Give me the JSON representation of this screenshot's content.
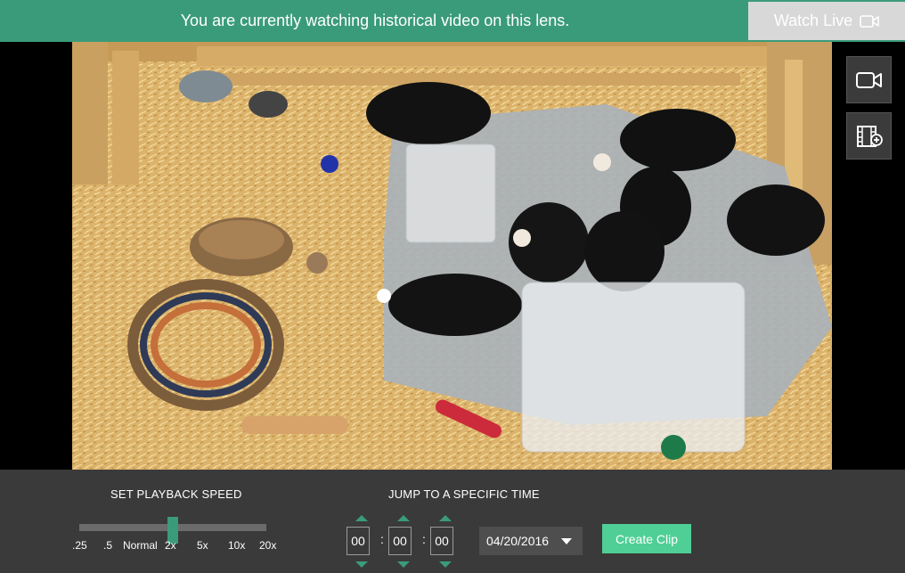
{
  "banner": {
    "message": "You are currently watching historical video on this lens.",
    "watch_live_label": "Watch Live",
    "watch_live_icon": "video-camera-icon"
  },
  "side_buttons": [
    {
      "name": "live-camera-button",
      "icon": "video-camera-icon"
    },
    {
      "name": "add-clip-button",
      "icon": "film-add-icon"
    }
  ],
  "controls": {
    "playback_title": "SET PLAYBACK SPEED",
    "speed_options": [
      ".25",
      ".5",
      "Normal",
      "2x",
      "5x",
      "10x",
      "20x"
    ],
    "selected_speed": "2x",
    "jump_title": "JUMP TO A SPECIFIC TIME",
    "time": {
      "hours": "00",
      "minutes": "00",
      "seconds": "00"
    },
    "date": "04/20/2016",
    "create_clip_label": "Create Clip"
  },
  "colors": {
    "accent": "#3a9b7a",
    "button": "#4fcf95",
    "control_bg": "#3a3a3a"
  }
}
